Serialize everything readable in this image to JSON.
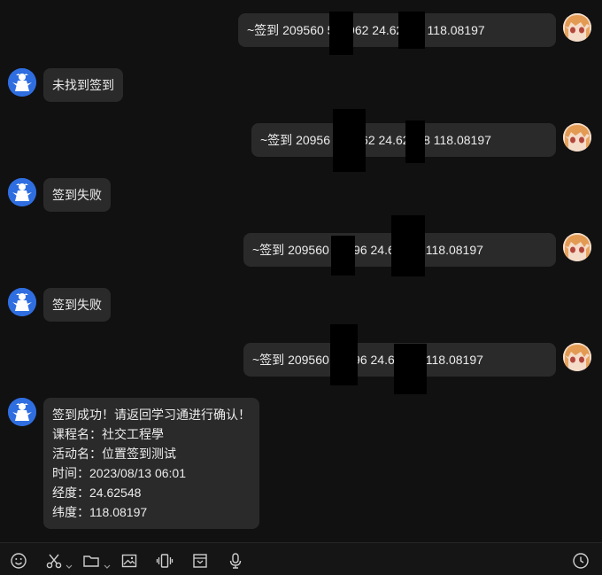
{
  "messages": [
    {
      "sender": "user",
      "text": "~签到 209560  567962  24.62548 118.08197"
    },
    {
      "sender": "bot",
      "text": "未找到签到"
    },
    {
      "sender": "user",
      "text": "~签到 20956  567962  24.62548 118.08197"
    },
    {
      "sender": "bot",
      "text": "签到失败"
    },
    {
      "sender": "user",
      "text": "~签到 209560  56796  24.62548 118.08197"
    },
    {
      "sender": "bot",
      "text": "签到失败"
    },
    {
      "sender": "user",
      "text": "~签到 209560  56796  24.62548 118.08197"
    },
    {
      "sender": "bot",
      "lines": [
        "签到成功！请返回学习通进行确认！",
        "课程名：社交工程學",
        "活动名：位置签到测试",
        "时间：2023/08/13 06:01",
        "经度：24.62548",
        "纬度：118.08197"
      ]
    }
  ],
  "toolbar": {
    "icons": [
      "emoji-icon",
      "scissors-icon",
      "folder-icon",
      "image-icon",
      "shake-icon",
      "inbox-icon",
      "microphone-icon",
      "history-icon"
    ]
  },
  "colors": {
    "background": "#111111",
    "bubble": "#2a2a2a",
    "text": "#ececec",
    "redaction": "#000000"
  }
}
